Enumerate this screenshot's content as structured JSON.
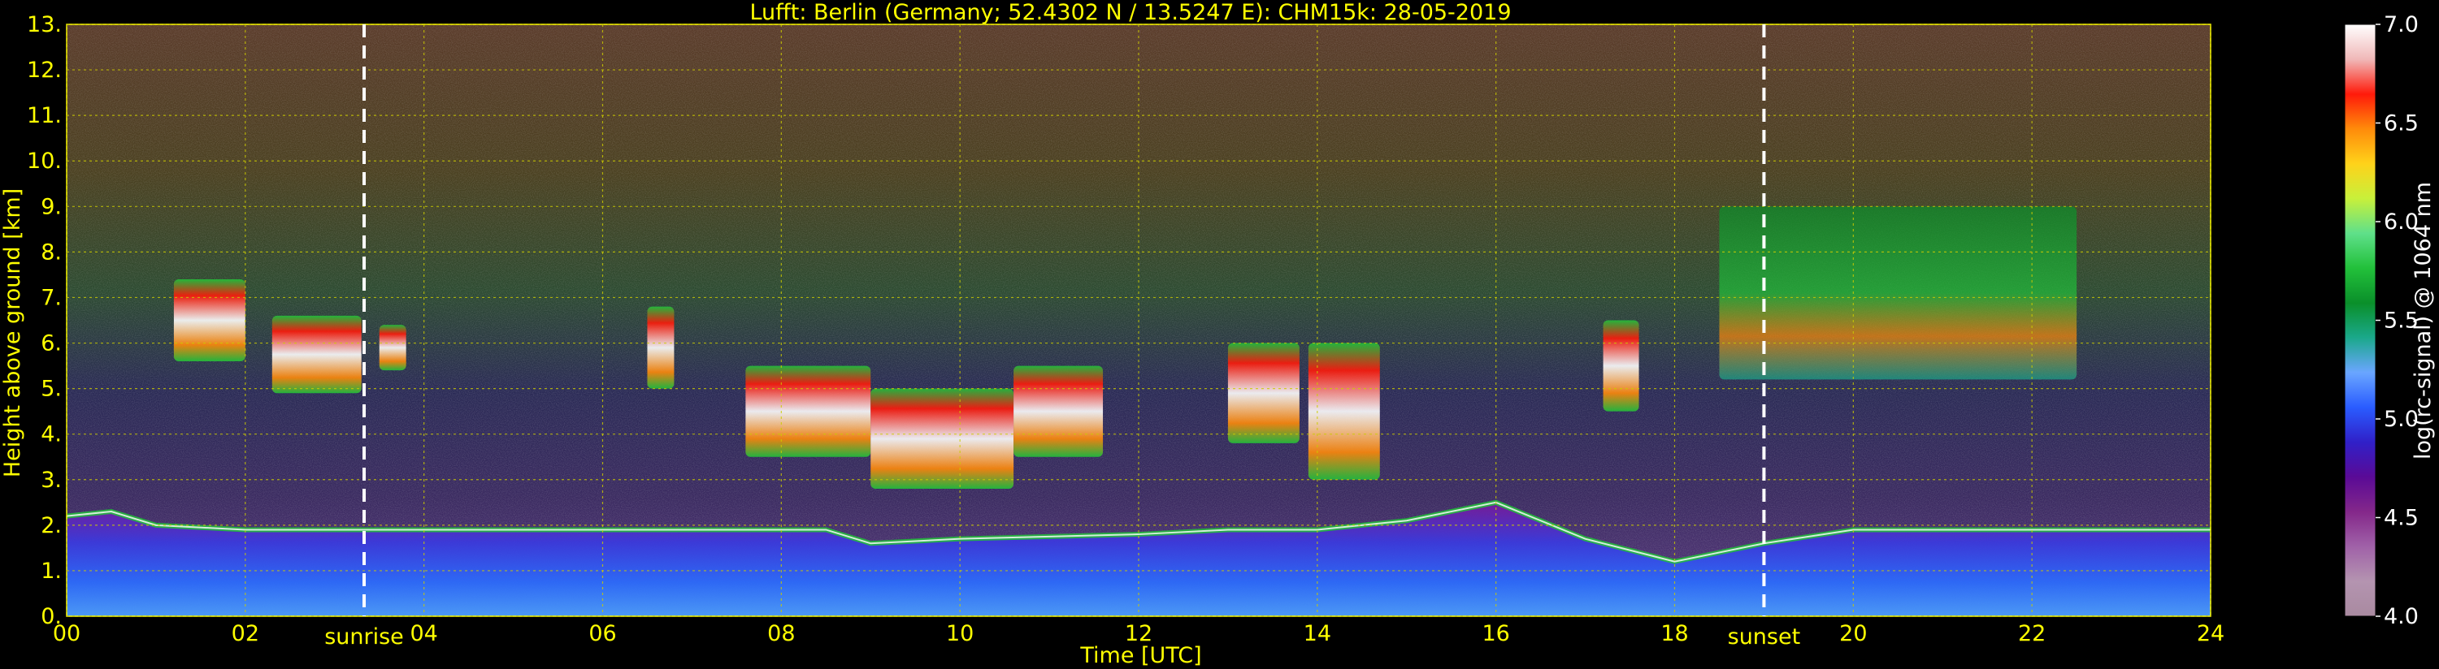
{
  "chart_data": {
    "type": "heatmap",
    "title": "Lufft: Berlin (Germany; 52.4302 N / 13.5247 E):    CHM15k: 28-05-2019",
    "xlabel": "Time [UTC]",
    "ylabel": "Height above ground [km]",
    "xlim": [
      0,
      24
    ],
    "ylim": [
      0,
      13
    ],
    "x_ticks": [
      "00",
      "02",
      "04",
      "06",
      "08",
      "10",
      "12",
      "14",
      "16",
      "18",
      "20",
      "22",
      "24"
    ],
    "x_tick_values": [
      0,
      2,
      4,
      6,
      8,
      10,
      12,
      14,
      16,
      18,
      20,
      22,
      24
    ],
    "y_ticks": [
      "0.",
      "1.",
      "2.",
      "3.",
      "4.",
      "5.",
      "6.",
      "7.",
      "8.",
      "9.",
      "10.",
      "11.",
      "12.",
      "13."
    ],
    "y_tick_values": [
      0,
      1,
      2,
      3,
      4,
      5,
      6,
      7,
      8,
      9,
      10,
      11,
      12,
      13
    ],
    "grid": true,
    "vlines": [
      {
        "x": 3.33,
        "label": "sunrise"
      },
      {
        "x": 19.0,
        "label": "sunset"
      }
    ],
    "colorbar": {
      "label": "log(rc-signal) @ 1064 nm",
      "range": [
        4.0,
        7.0
      ],
      "ticks": [
        "4.0",
        "4.5",
        "5.0",
        "5.5",
        "6.0",
        "6.5",
        "7.0"
      ],
      "tick_values": [
        4.0,
        4.5,
        5.0,
        5.5,
        6.0,
        6.5,
        7.0
      ],
      "colors": [
        "#a98aa0",
        "#b494b0",
        "#a061a8",
        "#84288a",
        "#5a0a96",
        "#3020c8",
        "#2a5cff",
        "#6aa6ff",
        "#1aa88a",
        "#0a8f2a",
        "#22c03a",
        "#5fe08a",
        "#c8f03a",
        "#ffd21a",
        "#ff8a0a",
        "#ff1a0a",
        "#f0b8b8",
        "#ffffff"
      ]
    },
    "features": {
      "boundary_layer_top_km": [
        {
          "x": 0,
          "y": 2.2
        },
        {
          "x": 0.5,
          "y": 2.3
        },
        {
          "x": 1,
          "y": 2.0
        },
        {
          "x": 2,
          "y": 1.9
        },
        {
          "x": 4,
          "y": 1.9
        },
        {
          "x": 6,
          "y": 1.9
        },
        {
          "x": 8.5,
          "y": 1.9
        },
        {
          "x": 9,
          "y": 1.6
        },
        {
          "x": 10,
          "y": 1.7
        },
        {
          "x": 11,
          "y": 1.75
        },
        {
          "x": 12,
          "y": 1.8
        },
        {
          "x": 13,
          "y": 1.9
        },
        {
          "x": 14,
          "y": 1.9
        },
        {
          "x": 15,
          "y": 2.1
        },
        {
          "x": 16,
          "y": 2.5
        },
        {
          "x": 16.5,
          "y": 2.1
        },
        {
          "x": 17,
          "y": 1.7
        },
        {
          "x": 18,
          "y": 1.2
        },
        {
          "x": 19,
          "y": 1.6
        },
        {
          "x": 20,
          "y": 1.9
        },
        {
          "x": 22,
          "y": 1.9
        },
        {
          "x": 24,
          "y": 1.9
        }
      ],
      "cloud_layers": [
        {
          "x0": 1.2,
          "x1": 2.0,
          "y0": 5.6,
          "y1": 7.4
        },
        {
          "x0": 2.3,
          "x1": 3.3,
          "y0": 4.9,
          "y1": 6.6
        },
        {
          "x0": 3.5,
          "x1": 3.8,
          "y0": 5.4,
          "y1": 6.4
        },
        {
          "x0": 6.5,
          "x1": 6.8,
          "y0": 5.0,
          "y1": 6.8
        },
        {
          "x0": 7.6,
          "x1": 9.0,
          "y0": 3.5,
          "y1": 5.5
        },
        {
          "x0": 9.0,
          "x1": 10.6,
          "y0": 2.8,
          "y1": 5.0
        },
        {
          "x0": 10.6,
          "x1": 11.6,
          "y0": 3.5,
          "y1": 5.5
        },
        {
          "x0": 13.0,
          "x1": 13.8,
          "y0": 3.8,
          "y1": 6.0
        },
        {
          "x0": 13.9,
          "x1": 14.7,
          "y0": 3.0,
          "y1": 6.0
        },
        {
          "x0": 17.2,
          "x1": 17.6,
          "y0": 4.5,
          "y1": 6.5
        },
        {
          "x0": 18.5,
          "x1": 22.5,
          "y0": 5.2,
          "y1": 9.0
        }
      ],
      "aerosol_layer_km": [
        {
          "x0": 0,
          "x1": 24,
          "y0": 0,
          "y1": 1.0
        },
        {
          "x0": 0,
          "x1": 24,
          "y0": 1.0,
          "y1": 2.0
        }
      ]
    }
  }
}
